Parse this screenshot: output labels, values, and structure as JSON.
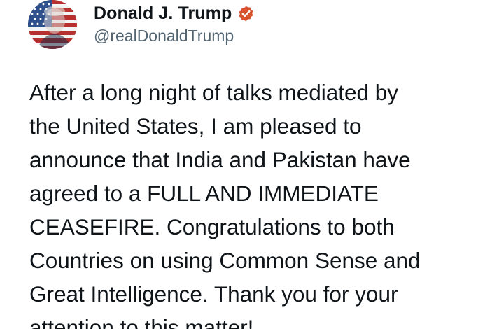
{
  "author": {
    "display_name": "Donald J. Trump",
    "handle": "@realDonaldTrump",
    "verified": true,
    "verified_badge_color": "#d6532b"
  },
  "post": {
    "text": "After a long night of talks mediated by\nthe United States, I am pleased to\nannounce that India and Pakistan have\nagreed to a FULL AND IMMEDIATE\nCEASEFIRE. Congratulations to both\nCountries on using Common Sense and\nGreat Intelligence. Thank you for your\nattention to this matter!"
  },
  "icons": {
    "avatar": "avatar-image",
    "verified": "verified-badge-icon"
  }
}
